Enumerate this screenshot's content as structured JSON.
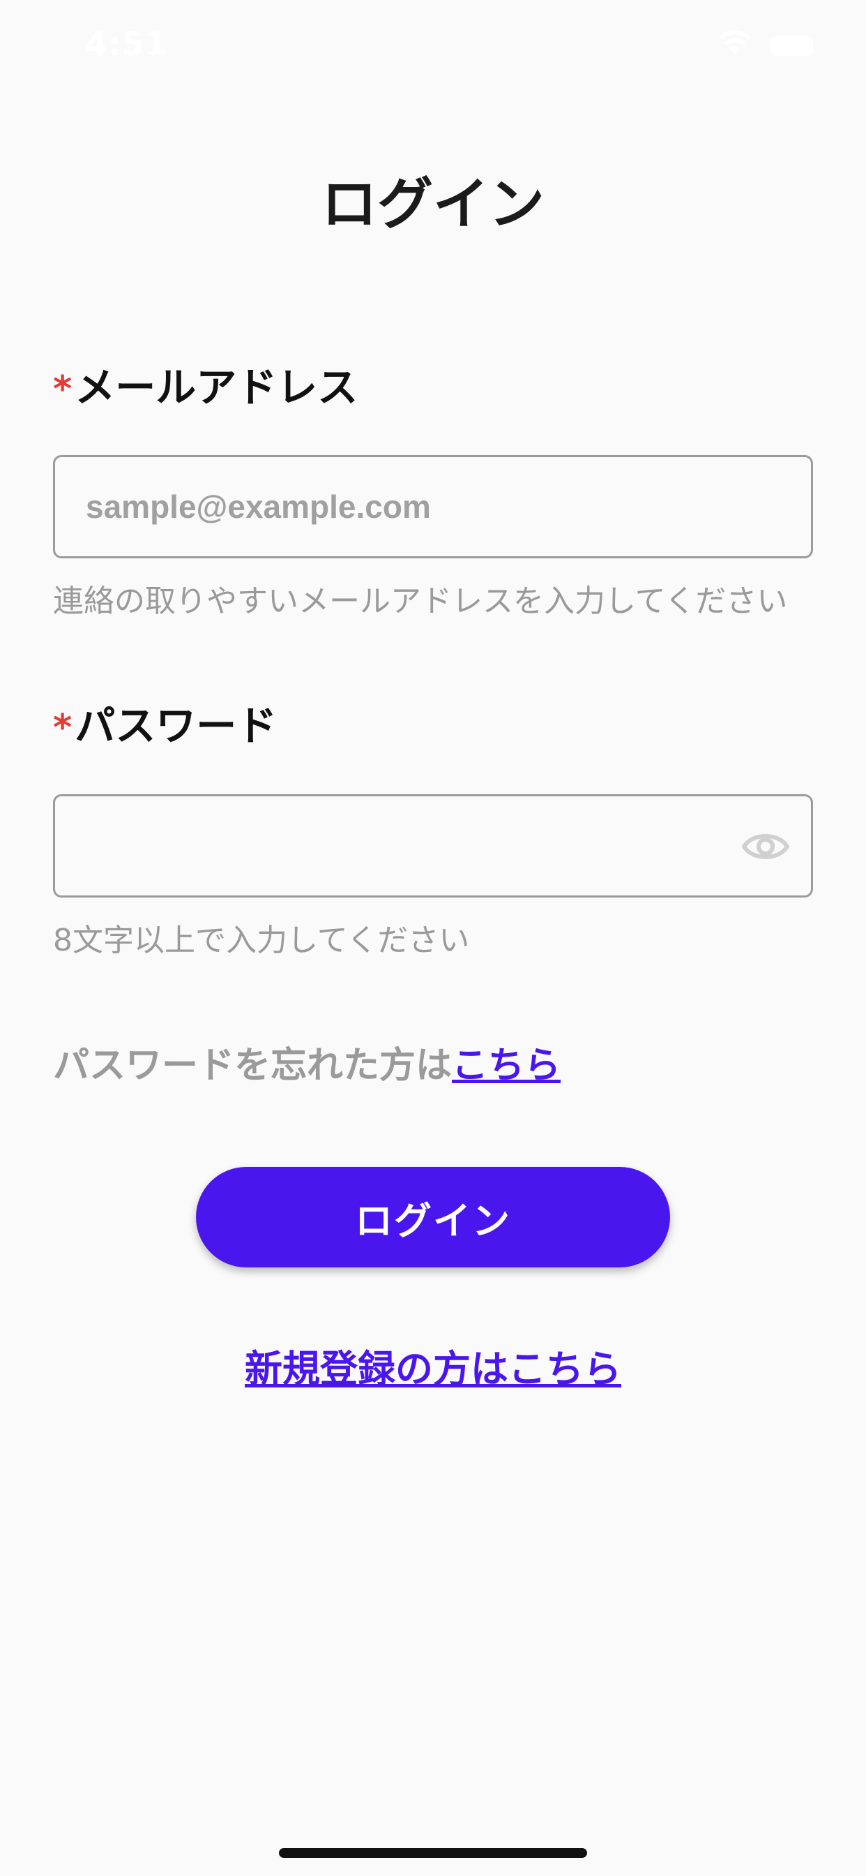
{
  "status_bar": {
    "time": "4:51",
    "wifi_icon": "wifi-icon",
    "battery_icon": "battery-icon"
  },
  "page": {
    "title": "ログイン"
  },
  "email": {
    "required_mark": "*",
    "label": "メールアドレス",
    "value": "",
    "placeholder": "sample@example.com",
    "helper": "連絡の取りやすいメールアドレスを入力してください"
  },
  "password": {
    "required_mark": "*",
    "label": "パスワード",
    "value": "",
    "placeholder": "",
    "toggle_icon": "eye-icon",
    "helper": "8文字以上で入力してください"
  },
  "forgot": {
    "text": "パスワードを忘れた方は",
    "link": "こちら"
  },
  "actions": {
    "login_label": "ログイン",
    "signup_link": "新規登録の方はこちら"
  },
  "colors": {
    "accent": "#4a16ee",
    "required": "#e53935",
    "helper_text": "#9a9a9a",
    "background": "#fafafa"
  }
}
